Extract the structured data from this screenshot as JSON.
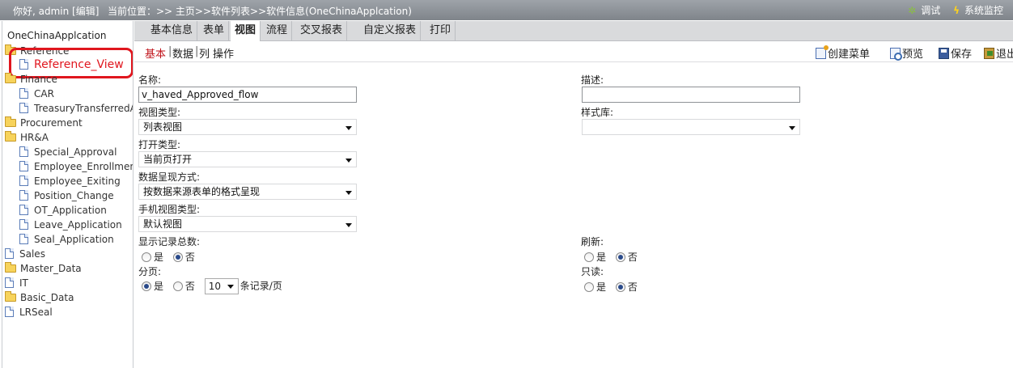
{
  "topbar": {
    "greeting": "你好, admin [编辑]",
    "breadcrumb": "当前位置：>> 主页>>软件列表>>软件信息(OneChinaApplcation)",
    "debug_label": "调试",
    "monitor_label": "系统监控"
  },
  "sidebar": {
    "root": "OneChinaApplcation",
    "items": {
      "reference": "Reference",
      "reference_view": "Reference_View",
      "finance": "Finance",
      "car": "CAR",
      "treasury": "TreasuryTransferredAp",
      "procurement": "Procurement",
      "hra": "HR&A",
      "special_approval": "Special_Approval",
      "employee_enrollment": "Employee_Enrollment",
      "employee_exiting": "Employee_Exiting",
      "position_change": "Position_Change",
      "ot_application": "OT_Application",
      "leave_application": "Leave_Application",
      "seal_application": "Seal_Application",
      "sales": "Sales",
      "master_data": "Master_Data",
      "it": "IT",
      "basic_data": "Basic_Data",
      "lrseal": "LRSeal"
    }
  },
  "tabs": {
    "basic": "基本信息",
    "form": "表单",
    "view": "视图",
    "flow": "流程",
    "cross": "交叉报表",
    "custom": "自定义报表",
    "print": "打印"
  },
  "subtabs": {
    "basic": "基本",
    "data": "数据",
    "column": "列",
    "operation": "操作"
  },
  "actions": {
    "create_menu": "创建菜单",
    "preview": "预览",
    "save": "保存",
    "exit": "退出"
  },
  "form": {
    "name_label": "名称:",
    "name_value": "v_haved_Approved_flow",
    "desc_label": "描述:",
    "desc_value": "",
    "view_type_label": "视图类型:",
    "view_type_value": "列表视图",
    "style_lib_label": "样式库:",
    "style_lib_value": "",
    "open_type_label": "打开类型:",
    "open_type_value": "当前页打开",
    "display_label": "数据呈现方式:",
    "display_value": "按数据来源表单的格式呈现",
    "mobile_label": "手机视图类型:",
    "mobile_value": "默认视图",
    "show_total_label": "显示记录总数:",
    "refresh_label": "刷新:",
    "paging_label": "分页:",
    "readonly_label": "只读:",
    "yes": "是",
    "no": "否",
    "page_size": "10",
    "per_page_suffix": "条记录/页"
  }
}
